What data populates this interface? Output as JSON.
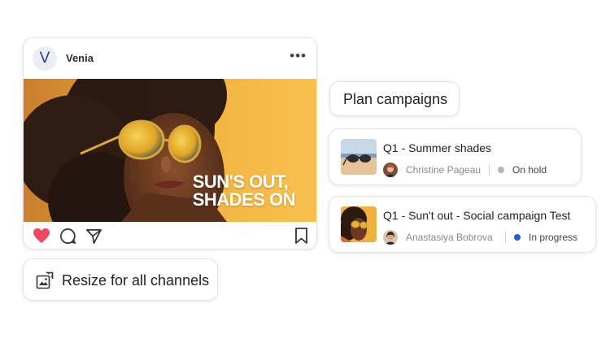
{
  "post": {
    "brand": "Venia",
    "brand_initial": "V",
    "more_label": "•••",
    "headline_line1": "SUN'S OUT,",
    "headline_line2": "SHADES ON"
  },
  "resize": {
    "label": "Resize for all channels"
  },
  "plan": {
    "label": "Plan campaigns"
  },
  "campaigns": [
    {
      "title": "Q1 - Summer shades",
      "owner": "Christine Pageau",
      "status": "On hold",
      "status_color": "#b5b5b5"
    },
    {
      "title": "Q1 - Sun't out - Social campaign Test",
      "owner": "Anastasiya Bobrova",
      "status": "In progress",
      "status_color": "#1a5fd6"
    }
  ],
  "icons": [
    "heart-icon",
    "comment-icon",
    "share-icon",
    "bookmark-icon",
    "resize-icon",
    "more-icon"
  ],
  "colors": {
    "like": "#f04a63",
    "in_progress": "#1a5fd6",
    "on_hold": "#b5b5b5",
    "image_bg": "#f3b63f"
  }
}
